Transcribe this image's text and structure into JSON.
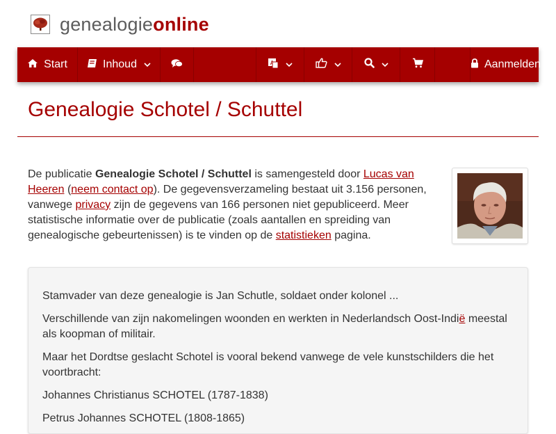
{
  "logo": {
    "part1": "genealogie",
    "part2": "online"
  },
  "nav": {
    "start": "Start",
    "contents": "Inhoud",
    "login": "Aanmelden"
  },
  "page": {
    "title": "Genealogie Schotel / Schuttel"
  },
  "intro": {
    "t1": "De publicatie ",
    "pubname": "Genealogie Schotel / Schuttel",
    "t2": " is samengesteld door ",
    "author": "Lucas van Heeren",
    "t3": " (",
    "contact": "neem contact op",
    "t4": "). De gegevensverzameling bestaat uit 3.156 personen, vanwege ",
    "privacy": "privacy",
    "t5": " zijn de gegevens van 166 personen niet gepubliceerd. Meer statistische informatie over de publicatie (zoals aantallen en spreiding van genealogische gebeurtenissen) is te vinden op de ",
    "stats": "statistieken",
    "t6": " pagina."
  },
  "panel": {
    "p1": "Stamvader van deze genealogie is Jan Schutle, soldaet onder kolonel ...",
    "p2a": "Verschillende van zijn nakomelingen woonden en werkten in Nederlandsch Oost-Indi",
    "p2link": "ë",
    "p2b": " meestal als koopman of militair.",
    "p3": "Maar het Dordtse geslacht Schotel is vooral bekend vanwege de vele kunstschilders die het voortbracht:",
    "p4": "Johannes Christianus SCHOTEL (1787-1838)",
    "p5": "Petrus Johannes SCHOTEL (1808-1865)"
  },
  "colors": {
    "brand": "#a50000",
    "panel_bg": "#f5f5f5",
    "text": "#333333"
  },
  "icons": [
    "tree-logo-icon",
    "home-icon",
    "book-icon",
    "chevron-down-icon",
    "comments-icon",
    "translate-icon",
    "thumbs-up-icon",
    "search-icon",
    "cart-icon",
    "lock-icon"
  ]
}
